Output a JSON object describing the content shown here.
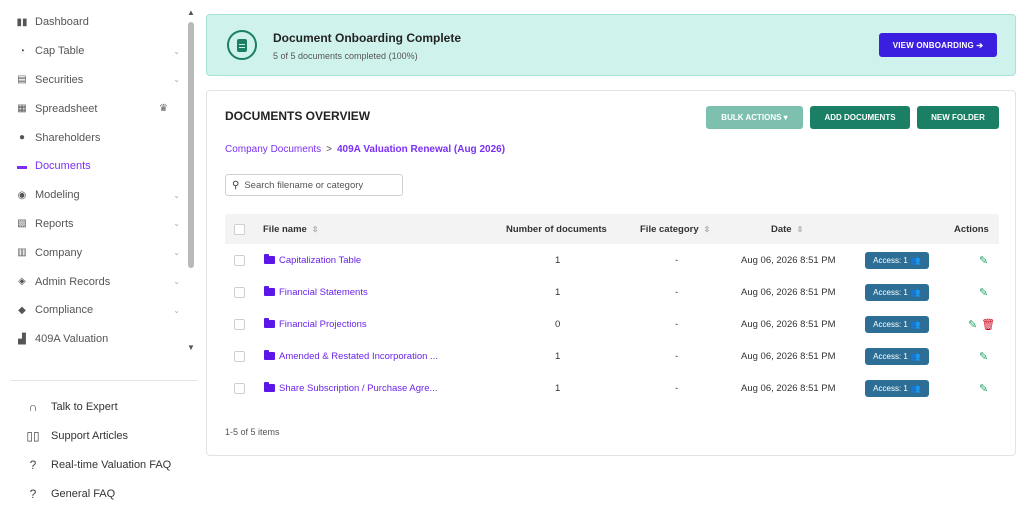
{
  "sidebar": {
    "items": [
      {
        "label": "Dashboard",
        "icon": "dashboard-icon",
        "glyph": "▮▮",
        "chevron": false,
        "crown": false,
        "active": false
      },
      {
        "label": "Cap Table",
        "icon": "pie-chart-icon",
        "glyph": "◔",
        "chevron": true,
        "crown": false,
        "active": false
      },
      {
        "label": "Securities",
        "icon": "clipboard-icon",
        "glyph": "▤",
        "chevron": true,
        "crown": false,
        "active": false
      },
      {
        "label": "Spreadsheet",
        "icon": "grid-icon",
        "glyph": "▦",
        "chevron": false,
        "crown": true,
        "active": false
      },
      {
        "label": "Shareholders",
        "icon": "person-icon",
        "glyph": "●",
        "chevron": false,
        "crown": false,
        "active": false
      },
      {
        "label": "Documents",
        "icon": "folder-icon",
        "glyph": "▬",
        "chevron": false,
        "crown": false,
        "active": true
      },
      {
        "label": "Modeling",
        "icon": "lightbulb-icon",
        "glyph": "◉",
        "chevron": true,
        "crown": false,
        "active": false
      },
      {
        "label": "Reports",
        "icon": "report-icon",
        "glyph": "▧",
        "chevron": true,
        "crown": false,
        "active": false
      },
      {
        "label": "Company",
        "icon": "building-icon",
        "glyph": "▥",
        "chevron": true,
        "crown": false,
        "active": false
      },
      {
        "label": "Admin Records",
        "icon": "admin-icon",
        "glyph": "◈",
        "chevron": true,
        "crown": false,
        "active": false
      },
      {
        "label": "Compliance",
        "icon": "shield-icon",
        "glyph": "◆",
        "chevron": true,
        "crown": false,
        "active": false
      },
      {
        "label": "409A Valuation",
        "icon": "valuation-icon",
        "glyph": "▟",
        "chevron": false,
        "crown": false,
        "active": false
      }
    ],
    "help": [
      {
        "label": "Talk to Expert",
        "icon": "headset-icon",
        "glyph": "∩"
      },
      {
        "label": "Support Articles",
        "icon": "book-icon",
        "glyph": "▯▯"
      },
      {
        "label": "Real-time Valuation FAQ",
        "icon": "question-icon",
        "glyph": "?"
      },
      {
        "label": "General FAQ",
        "icon": "question-icon",
        "glyph": "?"
      }
    ]
  },
  "banner": {
    "title": "Document Onboarding Complete",
    "subtitle": "5 of 5 documents completed (100%)",
    "button": "VIEW ONBOARDING ➔"
  },
  "overview": {
    "title": "DOCUMENTS OVERVIEW",
    "bulk_actions": "BULK ACTIONS ▾",
    "add_documents": "ADD DOCUMENTS",
    "new_folder": "NEW FOLDER",
    "breadcrumb_root": "Company Documents",
    "breadcrumb_sep": ">",
    "breadcrumb_current": "409A Valuation Renewal (Aug 2026)",
    "search_placeholder": "Search filename or category",
    "columns": {
      "file_name": "File name",
      "num_docs": "Number of documents",
      "category": "File category",
      "date": "Date",
      "actions": "Actions"
    },
    "rows": [
      {
        "name": "Capitalization Table",
        "count": "1",
        "category": "-",
        "date": "Aug 06, 2026 8:51 PM",
        "access": "Access: 1",
        "deletable": false
      },
      {
        "name": "Financial Statements",
        "count": "1",
        "category": "-",
        "date": "Aug 06, 2026 8:51 PM",
        "access": "Access: 1",
        "deletable": false
      },
      {
        "name": "Financial Projections",
        "count": "0",
        "category": "-",
        "date": "Aug 06, 2026 8:51 PM",
        "access": "Access: 1",
        "deletable": true
      },
      {
        "name": "Amended & Restated Incorporation ...",
        "count": "1",
        "category": "-",
        "date": "Aug 06, 2026 8:51 PM",
        "access": "Access: 1",
        "deletable": false
      },
      {
        "name": "Share Subscription / Purchase Agre...",
        "count": "1",
        "category": "-",
        "date": "Aug 06, 2026 8:51 PM",
        "access": "Access: 1",
        "deletable": false
      }
    ],
    "pagination": "1-5 of 5 items"
  }
}
